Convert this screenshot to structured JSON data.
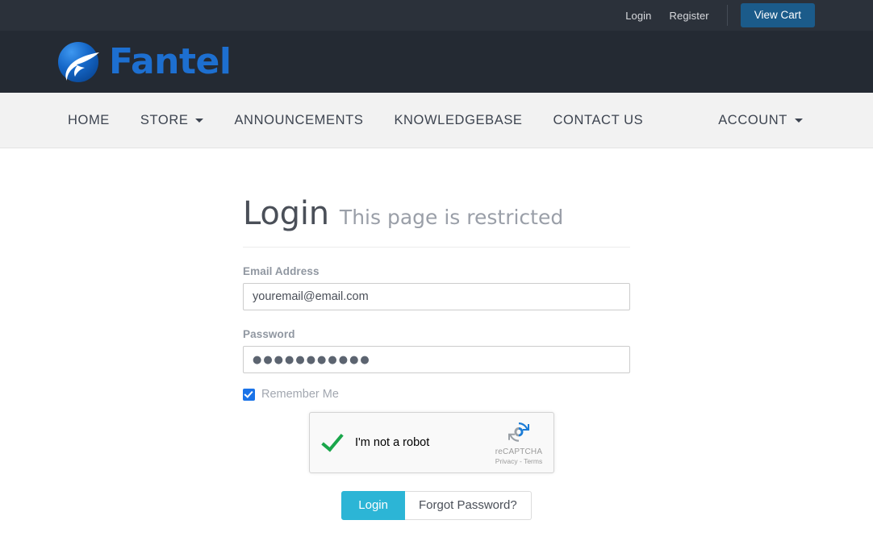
{
  "topbar": {
    "login_label": "Login",
    "register_label": "Register",
    "cart_label": "View Cart",
    "cart_bg": "#1b5b8a",
    "bg": "#2b313a"
  },
  "brand": {
    "name": "Fantel",
    "logo_icon": "fantel-feather-circle-icon",
    "text_color": "#1d6fd0",
    "band_bg": "#242a33"
  },
  "nav": {
    "bg": "#f2f2f2",
    "items": [
      {
        "label": "HOME",
        "has_caret": false
      },
      {
        "label": "STORE",
        "has_caret": true
      },
      {
        "label": "ANNOUNCEMENTS",
        "has_caret": false
      },
      {
        "label": "KNOWLEDGEBASE",
        "has_caret": false
      },
      {
        "label": "CONTACT US",
        "has_caret": false
      }
    ],
    "account": {
      "label": "ACCOUNT",
      "has_caret": true
    }
  },
  "page": {
    "title": "Login",
    "subtitle": "This page is restricted"
  },
  "form": {
    "email": {
      "label": "Email Address",
      "value": "youremail@email.com",
      "placeholder": "youremail@email.com"
    },
    "password": {
      "label": "Password",
      "value": "●●●●●●●●●●●",
      "placeholder": "Password"
    },
    "remember": {
      "label": "Remember Me",
      "checked": true,
      "accent": "#1a73e8"
    },
    "recaptcha": {
      "checkbox_state": "verified",
      "label": "I'm not a robot",
      "brand": "reCAPTCHA",
      "terms": "Privacy - Terms",
      "check_color": "#1aa64b"
    },
    "submit_label": "Login",
    "forgot_label": "Forgot Password?",
    "submit_bg": "#2cb5d6"
  }
}
